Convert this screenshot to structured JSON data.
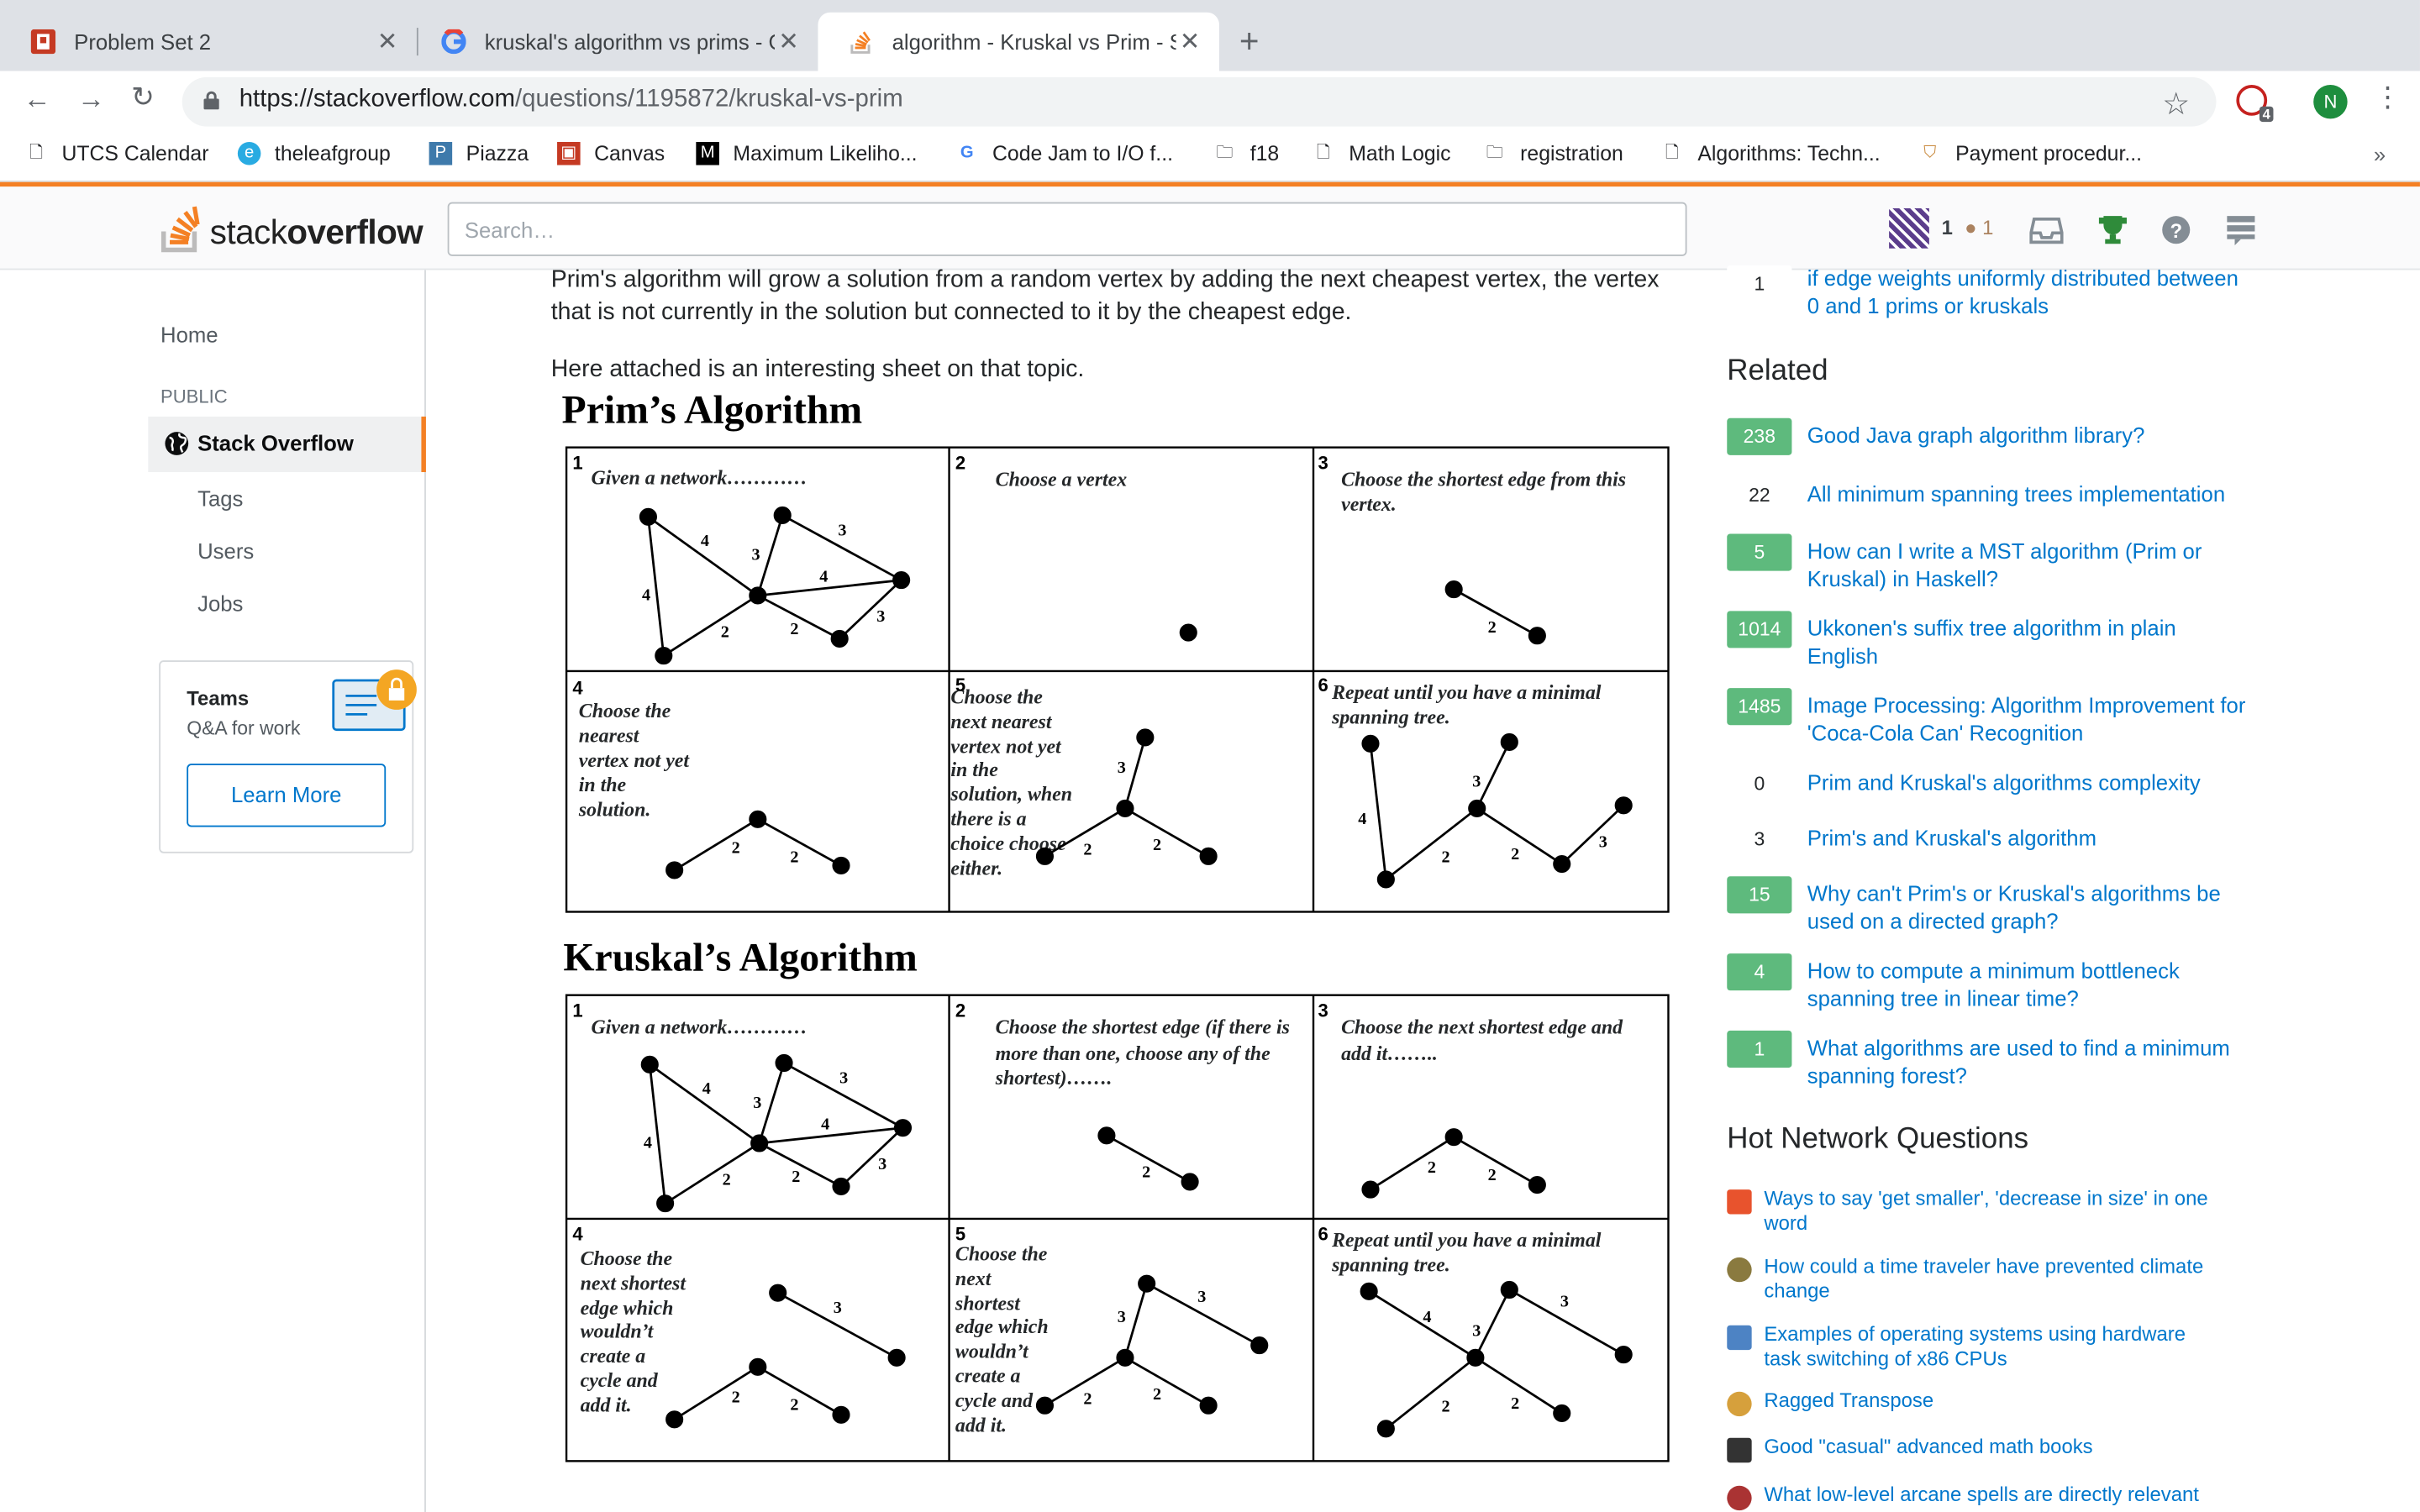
{
  "browser": {
    "tabs": [
      {
        "title": "Problem Set 2",
        "icon": "canvas-icon"
      },
      {
        "title": "kruskal's algorithm vs prims - G",
        "icon": "google-icon"
      },
      {
        "title": "algorithm - Kruskal vs Prim - S",
        "icon": "stackoverflow-icon"
      }
    ],
    "url_host": "https://stackoverflow.com",
    "url_path": "/questions/1195872/kruskal-vs-prim",
    "extension_badge": "4",
    "profile_initial": "N",
    "bookmarks": [
      "UTCS Calendar",
      "theleafgroup",
      "Piazza",
      "Canvas",
      "Maximum Likeliho...",
      "Code Jam to I/O f...",
      "f18",
      "Math Logic",
      "registration",
      "Algorithms: Techn...",
      "Payment procedur..."
    ],
    "bookmarks_more": "»"
  },
  "so": {
    "logo_light": "stack",
    "logo_bold": "overflow",
    "search_placeholder": "Search…",
    "reputation": "1",
    "bronze": "● 1"
  },
  "leftnav": {
    "home": "Home",
    "public": "PUBLIC",
    "stackoverflow": "Stack Overflow",
    "tags": "Tags",
    "users": "Users",
    "jobs": "Jobs",
    "teams_title": "Teams",
    "teams_sub": "Q&A for work",
    "teams_btn": "Learn More"
  },
  "post": {
    "para1": "Prim's algorithm will grow a solution from a random vertex by adding the next cheapest vertex, the vertex that is not currently in the solution but connected to it by the cheapest edge.",
    "para2": "Here attached is an interesting sheet on that topic."
  },
  "sheet": {
    "prim_title": "Prim’s Algorithm",
    "kruskal_title": "Kruskal’s Algorithm",
    "prim_steps": [
      {
        "n": "1",
        "text": "Given a network…………"
      },
      {
        "n": "2",
        "text": "Choose a vertex"
      },
      {
        "n": "3",
        "text": "Choose the shortest edge from this vertex."
      },
      {
        "n": "4",
        "text": "Choose the nearest vertex not yet in the solution."
      },
      {
        "n": "5",
        "text": "Choose the next nearest vertex not yet in the solution, when there is a choice choose either."
      },
      {
        "n": "6",
        "text": "Repeat until you have a minimal spanning tree."
      }
    ],
    "kruskal_steps": [
      {
        "n": "1",
        "text": "Given a network…………"
      },
      {
        "n": "2",
        "text": "Choose the shortest edge (if there is more than one, choose any of the shortest)……."
      },
      {
        "n": "3",
        "text": "Choose the next shortest edge and add it…….."
      },
      {
        "n": "4",
        "text": "Choose the next shortest edge which wouldn’t create a cycle and add it."
      },
      {
        "n": "5",
        "text": "Choose the next shortest edge which wouldn’t create a cycle and add it."
      },
      {
        "n": "6",
        "text": "Repeat until you have a minimal spanning tree."
      }
    ]
  },
  "sidebar": {
    "top_linked": {
      "count": "1",
      "title": "if edge weights uniformly distributed between 0 and 1 prims or kruskals"
    },
    "related_title": "Related",
    "related": [
      {
        "count": "238",
        "answered": true,
        "title": "Good Java graph algorithm library?"
      },
      {
        "count": "22",
        "answered": false,
        "title": "All minimum spanning trees implementation"
      },
      {
        "count": "5",
        "answered": true,
        "title": "How can I write a MST algorithm (Prim or Kruskal) in Haskell?"
      },
      {
        "count": "1014",
        "answered": true,
        "title": "Ukkonen's suffix tree algorithm in plain English"
      },
      {
        "count": "1485",
        "answered": true,
        "title": "Image Processing: Algorithm Improvement for 'Coca-Cola Can' Recognition"
      },
      {
        "count": "0",
        "answered": false,
        "title": "Prim and Kruskal's algorithms complexity"
      },
      {
        "count": "3",
        "answered": false,
        "title": "Prim's and Kruskal's algorithm"
      },
      {
        "count": "15",
        "answered": true,
        "title": "Why can't Prim's or Kruskal's algorithms be used on a directed graph?"
      },
      {
        "count": "4",
        "answered": true,
        "title": "How to compute a minimum bottleneck spanning tree in linear time?"
      },
      {
        "count": "1",
        "answered": true,
        "title": "What algorithms are used to find a minimum spanning forest?"
      }
    ],
    "hnq_title": "Hot Network Questions",
    "hnq": [
      {
        "icon": "english-se-icon",
        "title": "Ways to say 'get smaller', 'decrease in size' in one word"
      },
      {
        "icon": "worldbuilding-icon",
        "title": "How could a time traveler have prevented climate change"
      },
      {
        "icon": "retrocomputing-icon",
        "title": "Examples of operating systems using hardware task switching of x86 CPUs"
      },
      {
        "icon": "codegolf-icon",
        "title": "Ragged Transpose"
      },
      {
        "icon": "mathoverflow-icon",
        "title": "Good \"casual\" advanced math books"
      },
      {
        "icon": "rpg-icon",
        "title": "What low-level arcane spells are directly relevant"
      }
    ]
  }
}
